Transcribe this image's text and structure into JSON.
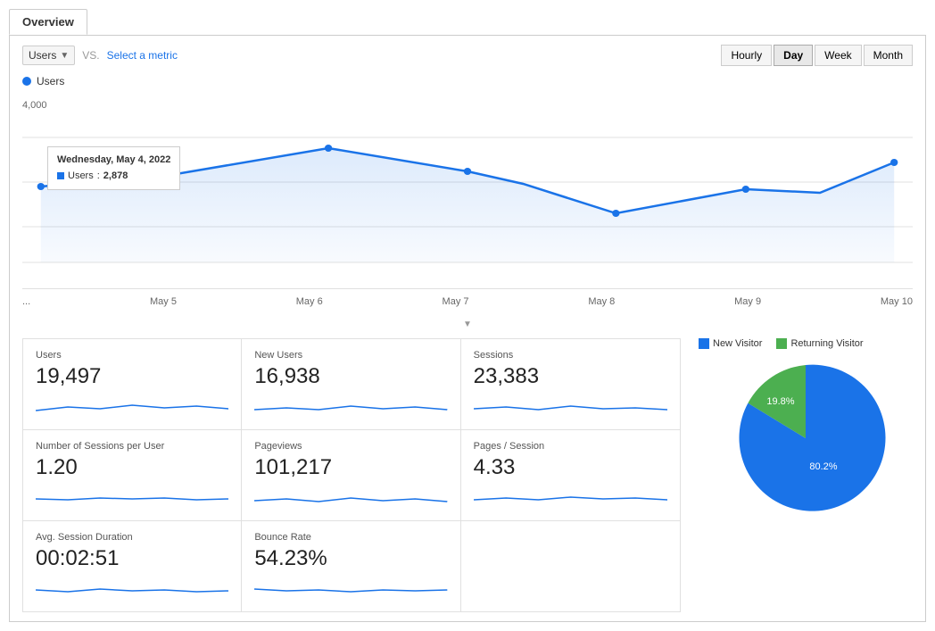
{
  "tabs": [
    {
      "label": "Overview",
      "active": true
    }
  ],
  "controls": {
    "metric_selector": "Users",
    "vs_label": "VS.",
    "select_metric": "Select a metric",
    "time_buttons": [
      "Hourly",
      "Day",
      "Week",
      "Month"
    ],
    "active_time": "Day"
  },
  "chart": {
    "legend_label": "Users",
    "y_axis_label": "4,000",
    "tooltip": {
      "date": "Wednesday, May 4, 2022",
      "metric": "Users",
      "value": "2,878"
    },
    "x_labels": [
      "...",
      "May 5",
      "May 6",
      "May 7",
      "May 8",
      "May 9",
      "May 10"
    ]
  },
  "metrics": [
    {
      "label": "Users",
      "value": "19,497"
    },
    {
      "label": "New Users",
      "value": "16,938"
    },
    {
      "label": "Sessions",
      "value": "23,383"
    },
    {
      "label": "Number of Sessions per User",
      "value": "1.20"
    },
    {
      "label": "Pageviews",
      "value": "101,217"
    },
    {
      "label": "Pages / Session",
      "value": "4.33"
    },
    {
      "label": "Avg. Session Duration",
      "value": "00:02:51"
    },
    {
      "label": "Bounce Rate",
      "value": "54.23%"
    }
  ],
  "pie": {
    "legend": [
      {
        "label": "New Visitor",
        "color": "new",
        "pct": 80.2
      },
      {
        "label": "Returning Visitor",
        "color": "returning",
        "pct": 19.8
      }
    ],
    "new_pct": 80.2,
    "returning_pct": 19.8,
    "new_label": "80.2%",
    "returning_label": "19.8%",
    "colors": {
      "new": "#1a73e8",
      "returning": "#4caf50"
    }
  }
}
